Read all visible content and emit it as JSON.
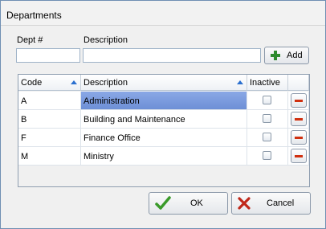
{
  "window": {
    "title": "Departments"
  },
  "form": {
    "dept_label": "Dept #",
    "dept_value": "",
    "description_label": "Description",
    "description_value": "",
    "add_label": "Add"
  },
  "grid": {
    "columns": {
      "code": "Code",
      "description": "Description",
      "inactive": "Inactive"
    },
    "rows": [
      {
        "code": "A",
        "description": "Administration",
        "inactive": false
      },
      {
        "code": "B",
        "description": "Building and Maintenance",
        "inactive": false
      },
      {
        "code": "F",
        "description": "Finance Office",
        "inactive": false
      },
      {
        "code": "M",
        "description": "Ministry",
        "inactive": false
      }
    ]
  },
  "buttons": {
    "ok_label": "OK",
    "cancel_label": "Cancel"
  },
  "colors": {
    "selection": "#7b9ade",
    "delete": "#d03010",
    "add": "#2e8b2e",
    "ok": "#3a9a2a",
    "cancel": "#c0281a"
  },
  "icons": {
    "add": "plus-icon",
    "delete": "minus-icon",
    "ok": "checkmark-icon",
    "cancel": "x-icon",
    "sort": "sort-up-icon"
  }
}
